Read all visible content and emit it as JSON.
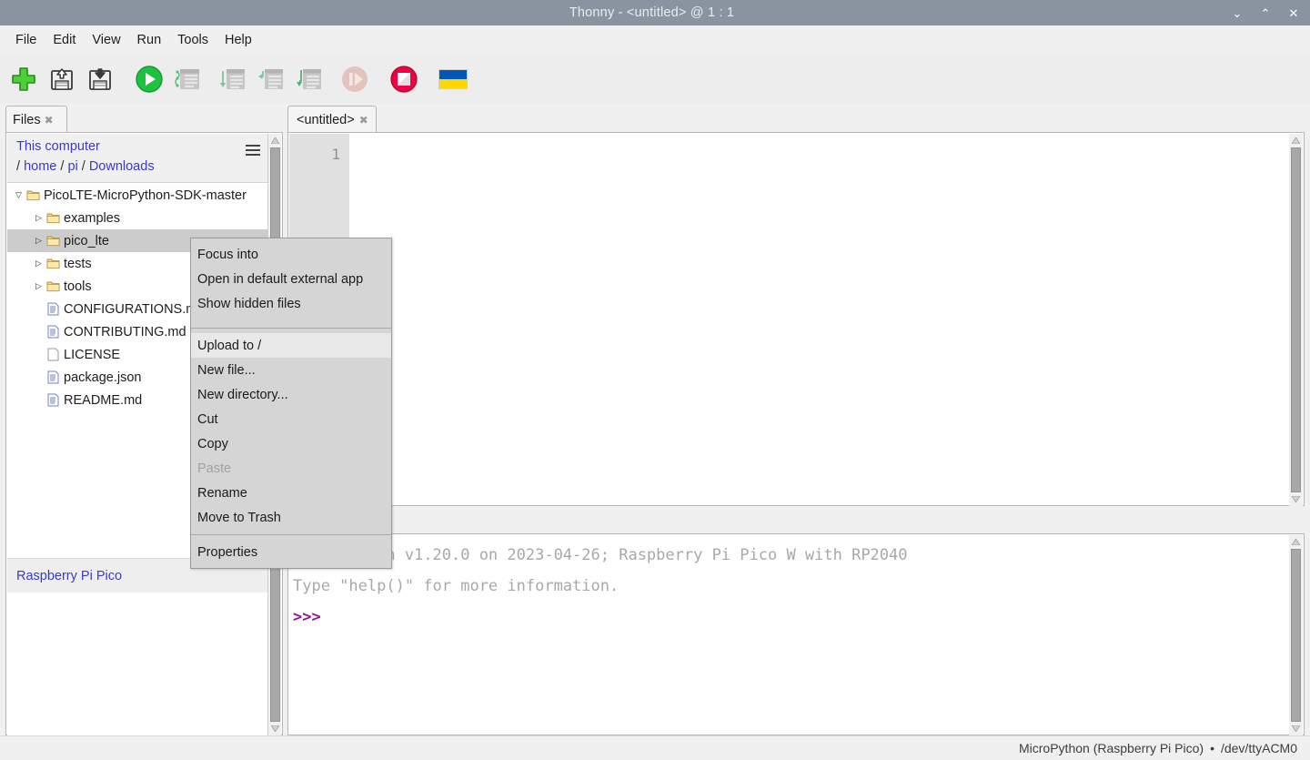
{
  "window": {
    "title": "Thonny  -  <untitled> @  1 : 1",
    "controls": [
      {
        "name": "minimize",
        "glyph": "⌄"
      },
      {
        "name": "maximize",
        "glyph": "⌃"
      },
      {
        "name": "close",
        "glyph": "✕"
      }
    ]
  },
  "menubar": {
    "items": [
      "File",
      "Edit",
      "View",
      "Run",
      "Tools",
      "Help"
    ]
  },
  "toolbar": {
    "buttons": [
      {
        "name": "new-file-button",
        "icon": "plus-icon",
        "title": "New",
        "enabled": true
      },
      {
        "name": "open-file-button",
        "icon": "open-floppy-icon",
        "title": "Load",
        "enabled": true
      },
      {
        "name": "save-file-button",
        "icon": "save-floppy-icon",
        "title": "Save",
        "enabled": true
      },
      {
        "name": "run-button",
        "icon": "play-icon",
        "title": "Run current script",
        "enabled": true
      },
      {
        "name": "debug-button",
        "icon": "debug-icon",
        "title": "Debug current script",
        "enabled": false
      },
      {
        "name": "step-over-button",
        "icon": "step-over-icon",
        "title": "Step over",
        "enabled": false
      },
      {
        "name": "step-into-button",
        "icon": "step-into-icon",
        "title": "Step into",
        "enabled": false
      },
      {
        "name": "step-out-button",
        "icon": "step-out-icon",
        "title": "Step out",
        "enabled": false
      },
      {
        "name": "resume-button",
        "icon": "resume-icon",
        "title": "Resume",
        "enabled": false
      },
      {
        "name": "stop-button",
        "icon": "stop-icon",
        "title": "Stop/Restart backend",
        "enabled": true
      },
      {
        "name": "ukraine-flag-button",
        "icon": "ukraine-flag-icon",
        "title": "Support Ukraine",
        "enabled": true
      }
    ]
  },
  "files_panel": {
    "tab_label": "Files",
    "tab_close": "✖",
    "location_label": "This computer",
    "path_segments": [
      "home",
      "pi",
      "Downloads"
    ],
    "path_separator": "/",
    "menu_icon": "hamburger-icon",
    "tree": [
      {
        "label": "PicoLTE-MicroPython-SDK-master",
        "type": "folder",
        "indent": 0,
        "arrow": "▽",
        "selected": false
      },
      {
        "label": "examples",
        "type": "folder",
        "indent": 1,
        "arrow": "▷",
        "selected": false
      },
      {
        "label": "pico_lte",
        "type": "folder",
        "indent": 1,
        "arrow": "▷",
        "selected": true
      },
      {
        "label": "tests",
        "type": "folder",
        "indent": 1,
        "arrow": "▷",
        "selected": false
      },
      {
        "label": "tools",
        "type": "folder",
        "indent": 1,
        "arrow": "▷",
        "selected": false
      },
      {
        "label": "CONFIGURATIONS.md",
        "type": "file-text",
        "indent": 1,
        "arrow": "",
        "selected": false
      },
      {
        "label": "CONTRIBUTING.md",
        "type": "file-text",
        "indent": 1,
        "arrow": "",
        "selected": false
      },
      {
        "label": "LICENSE",
        "type": "file-blank",
        "indent": 1,
        "arrow": "",
        "selected": false
      },
      {
        "label": "package.json",
        "type": "file-text",
        "indent": 1,
        "arrow": "",
        "selected": false
      },
      {
        "label": "README.md",
        "type": "file-text",
        "indent": 1,
        "arrow": "",
        "selected": false
      }
    ],
    "device_label": "Raspberry Pi Pico"
  },
  "editor": {
    "tab_label": "<untitled>",
    "tab_close": "✖",
    "line_numbers": [
      "1"
    ],
    "content": ""
  },
  "shell": {
    "lines": [
      {
        "text": "MicroPython v1.20.0 on 2023-04-26; Raspberry Pi Pico W with RP2040",
        "kind": "out"
      },
      {
        "text": "Type \"help()\" for more information.",
        "kind": "out"
      },
      {
        "text": ">>>",
        "kind": "prompt"
      }
    ]
  },
  "statusbar": {
    "interpreter": "MicroPython (Raspberry Pi Pico)",
    "separator": "•",
    "port": "/dev/ttyACM0"
  },
  "context_menu": {
    "items": [
      {
        "label": "Focus into",
        "state": "normal"
      },
      {
        "label": "Open in default external app",
        "state": "normal"
      },
      {
        "label": "Show hidden files",
        "state": "normal"
      },
      {
        "label": "",
        "state": "separator"
      },
      {
        "label": "Upload to /",
        "state": "highlighted"
      },
      {
        "label": "New file...",
        "state": "normal"
      },
      {
        "label": "New directory...",
        "state": "normal"
      },
      {
        "label": "Cut",
        "state": "normal"
      },
      {
        "label": "Copy",
        "state": "normal"
      },
      {
        "label": "Paste",
        "state": "disabled"
      },
      {
        "label": "Rename",
        "state": "normal"
      },
      {
        "label": "Move to Trash",
        "state": "normal"
      },
      {
        "label": "",
        "state": "separator"
      },
      {
        "label": "Properties",
        "state": "normal"
      }
    ]
  },
  "colors": {
    "titlebar": "#8a94a0",
    "chrome": "#f0f0f0",
    "accent_link": "#3b3bbf",
    "prompt": "#8c1a8c",
    "run_green": "#22bb44",
    "stop_red": "#e8003c",
    "selection": "#cccccc"
  }
}
